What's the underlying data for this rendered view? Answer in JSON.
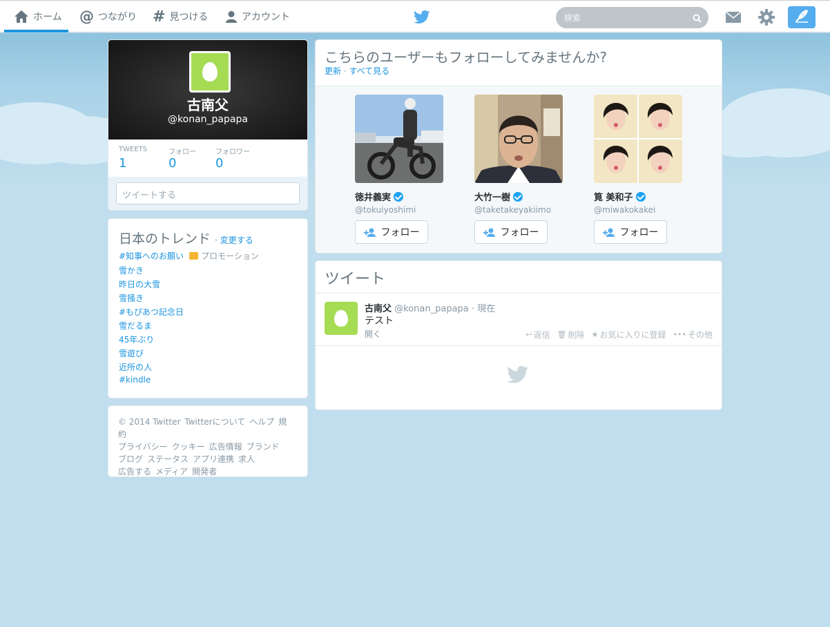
{
  "nav": {
    "home": "ホーム",
    "connect": "つながり",
    "discover": "見つける",
    "account": "アカウント",
    "search_placeholder": "検索"
  },
  "profile": {
    "name": "古南父",
    "handle": "@konan_papapa",
    "tweets_label": "TWEETS",
    "tweets": "1",
    "following_label": "フォロー",
    "following": "0",
    "followers_label": "フォロワー",
    "followers": "0",
    "compose_placeholder": "ツイートする"
  },
  "trends": {
    "title": "日本のトレンド",
    "change": "· 変更する",
    "promoted_label": "プロモーション",
    "items": [
      "#知事へのお願い",
      "雪かき",
      "昨日の大雪",
      "雪掻き",
      "#もぴあつ記念日",
      "雪だるま",
      "45年ぶり",
      "雪遊び",
      "近所の人",
      "#kindle"
    ]
  },
  "footer": {
    "links": [
      "© 2014 Twitter",
      "Twitterについて",
      "ヘルプ",
      "規約",
      "プライバシー",
      "クッキー",
      "広告情報",
      "ブランド",
      "ブログ",
      "ステータス",
      "アプリ連携",
      "求人",
      "広告する",
      "メディア",
      "開発者"
    ]
  },
  "who_to_follow": {
    "title": "こちらのユーザーもフォローしてみませんか?",
    "refresh": "更新",
    "sep": "·",
    "view_all": "すべて見る",
    "follow_label": "フォロー",
    "users": [
      {
        "name": "徳井義実",
        "handle": "@tokuiyoshimi"
      },
      {
        "name": "大竹一樹",
        "handle": "@taketakeyakiimo"
      },
      {
        "name": "筧 美和子",
        "handle": "@miwakokakei"
      }
    ]
  },
  "tweets": {
    "title": "ツイート",
    "items": [
      {
        "name": "古南父",
        "handle": "@konan_papapa",
        "time": "· 現在",
        "text": "テスト",
        "open": "開く",
        "reply": "返信",
        "delete": "削除",
        "favorite": "お気に入りに登録",
        "more": "その他"
      }
    ]
  },
  "colors": {
    "accent": "#1b95e0",
    "egg_green": "#a5dc54",
    "background": "#c0deed"
  }
}
